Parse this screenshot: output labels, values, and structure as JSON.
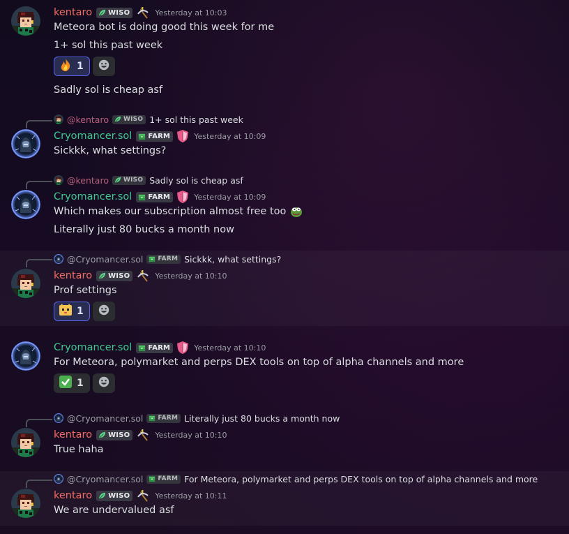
{
  "users": {
    "kentaro": {
      "name": "kentaro",
      "mention": "@kentaro",
      "tag": "WISO",
      "color": "#f06d63"
    },
    "cryo": {
      "name": "Cryomancer.sol",
      "mention": "@Cryomancer.sol",
      "tag": "FARM",
      "color": "#41c890"
    }
  },
  "messages": [
    {
      "author": "kentaro",
      "tag": "WISO",
      "timestamp": "Yesterday at 10:03",
      "lines": [
        "Meteora bot is doing good this week for me",
        "1+ sol this past week"
      ],
      "reaction": {
        "emoji": "fire",
        "count": "1"
      },
      "extra_line": "Sadly sol is cheap asf"
    },
    {
      "reply_to": {
        "name": "@kentaro",
        "tag": "WISO",
        "text": "1+ sol this past week"
      },
      "author": "Cryomancer.sol",
      "tag": "FARM",
      "timestamp": "Yesterday at 10:09",
      "lines": [
        "Sickkk, what settings?"
      ]
    },
    {
      "reply_to": {
        "name": "@kentaro",
        "tag": "WISO",
        "text": "Sadly sol is cheap asf"
      },
      "author": "Cryomancer.sol",
      "tag": "FARM",
      "timestamp": "Yesterday at 10:09",
      "lines": [
        "Which makes our subscription almost free too",
        "Literally just 80 bucks a month now"
      ]
    },
    {
      "reply_to": {
        "name": "@Cryomancer.sol",
        "tag": "FARM",
        "text": "Sickkk, what settings?"
      },
      "author": "kentaro",
      "tag": "WISO",
      "timestamp": "Yesterday at 10:10",
      "lines": [
        "Prof settings"
      ],
      "reaction": {
        "emoji": "cat-face",
        "count": "1"
      }
    },
    {
      "author": "Cryomancer.sol",
      "tag": "FARM",
      "timestamp": "Yesterday at 10:10",
      "lines": [
        "For Meteora, polymarket and perps DEX tools on top of alpha channels and more"
      ],
      "reaction": {
        "emoji": "check-mark",
        "count": "1"
      }
    },
    {
      "reply_to": {
        "name": "@Cryomancer.sol",
        "tag": "FARM",
        "text": "Literally just 80 bucks a month now"
      },
      "author": "kentaro",
      "tag": "WISO",
      "timestamp": "Yesterday at 10:10",
      "lines": [
        "True haha"
      ]
    },
    {
      "reply_to": {
        "name": "@Cryomancer.sol",
        "tag": "FARM",
        "text": "For Meteora, polymarket and perps DEX tools on top of alpha channels and more"
      },
      "author": "kentaro",
      "tag": "WISO",
      "timestamp": "Yesterday at 10:11",
      "lines": [
        "We are undervalued asf"
      ]
    }
  ],
  "icons": {
    "wiso_tag": "leaf-icon",
    "farm_tag": "money-stack-icon",
    "kentaro_role": "pickaxe-4-icon",
    "cryo_role": "shield-icon",
    "add_reaction": "smiley-add-icon"
  },
  "colors": {
    "kentaro_name": "#f06d63",
    "cryo_name": "#41c890",
    "reaction_active_border": "#5865f2",
    "timestamp": "#9a9ca3"
  }
}
